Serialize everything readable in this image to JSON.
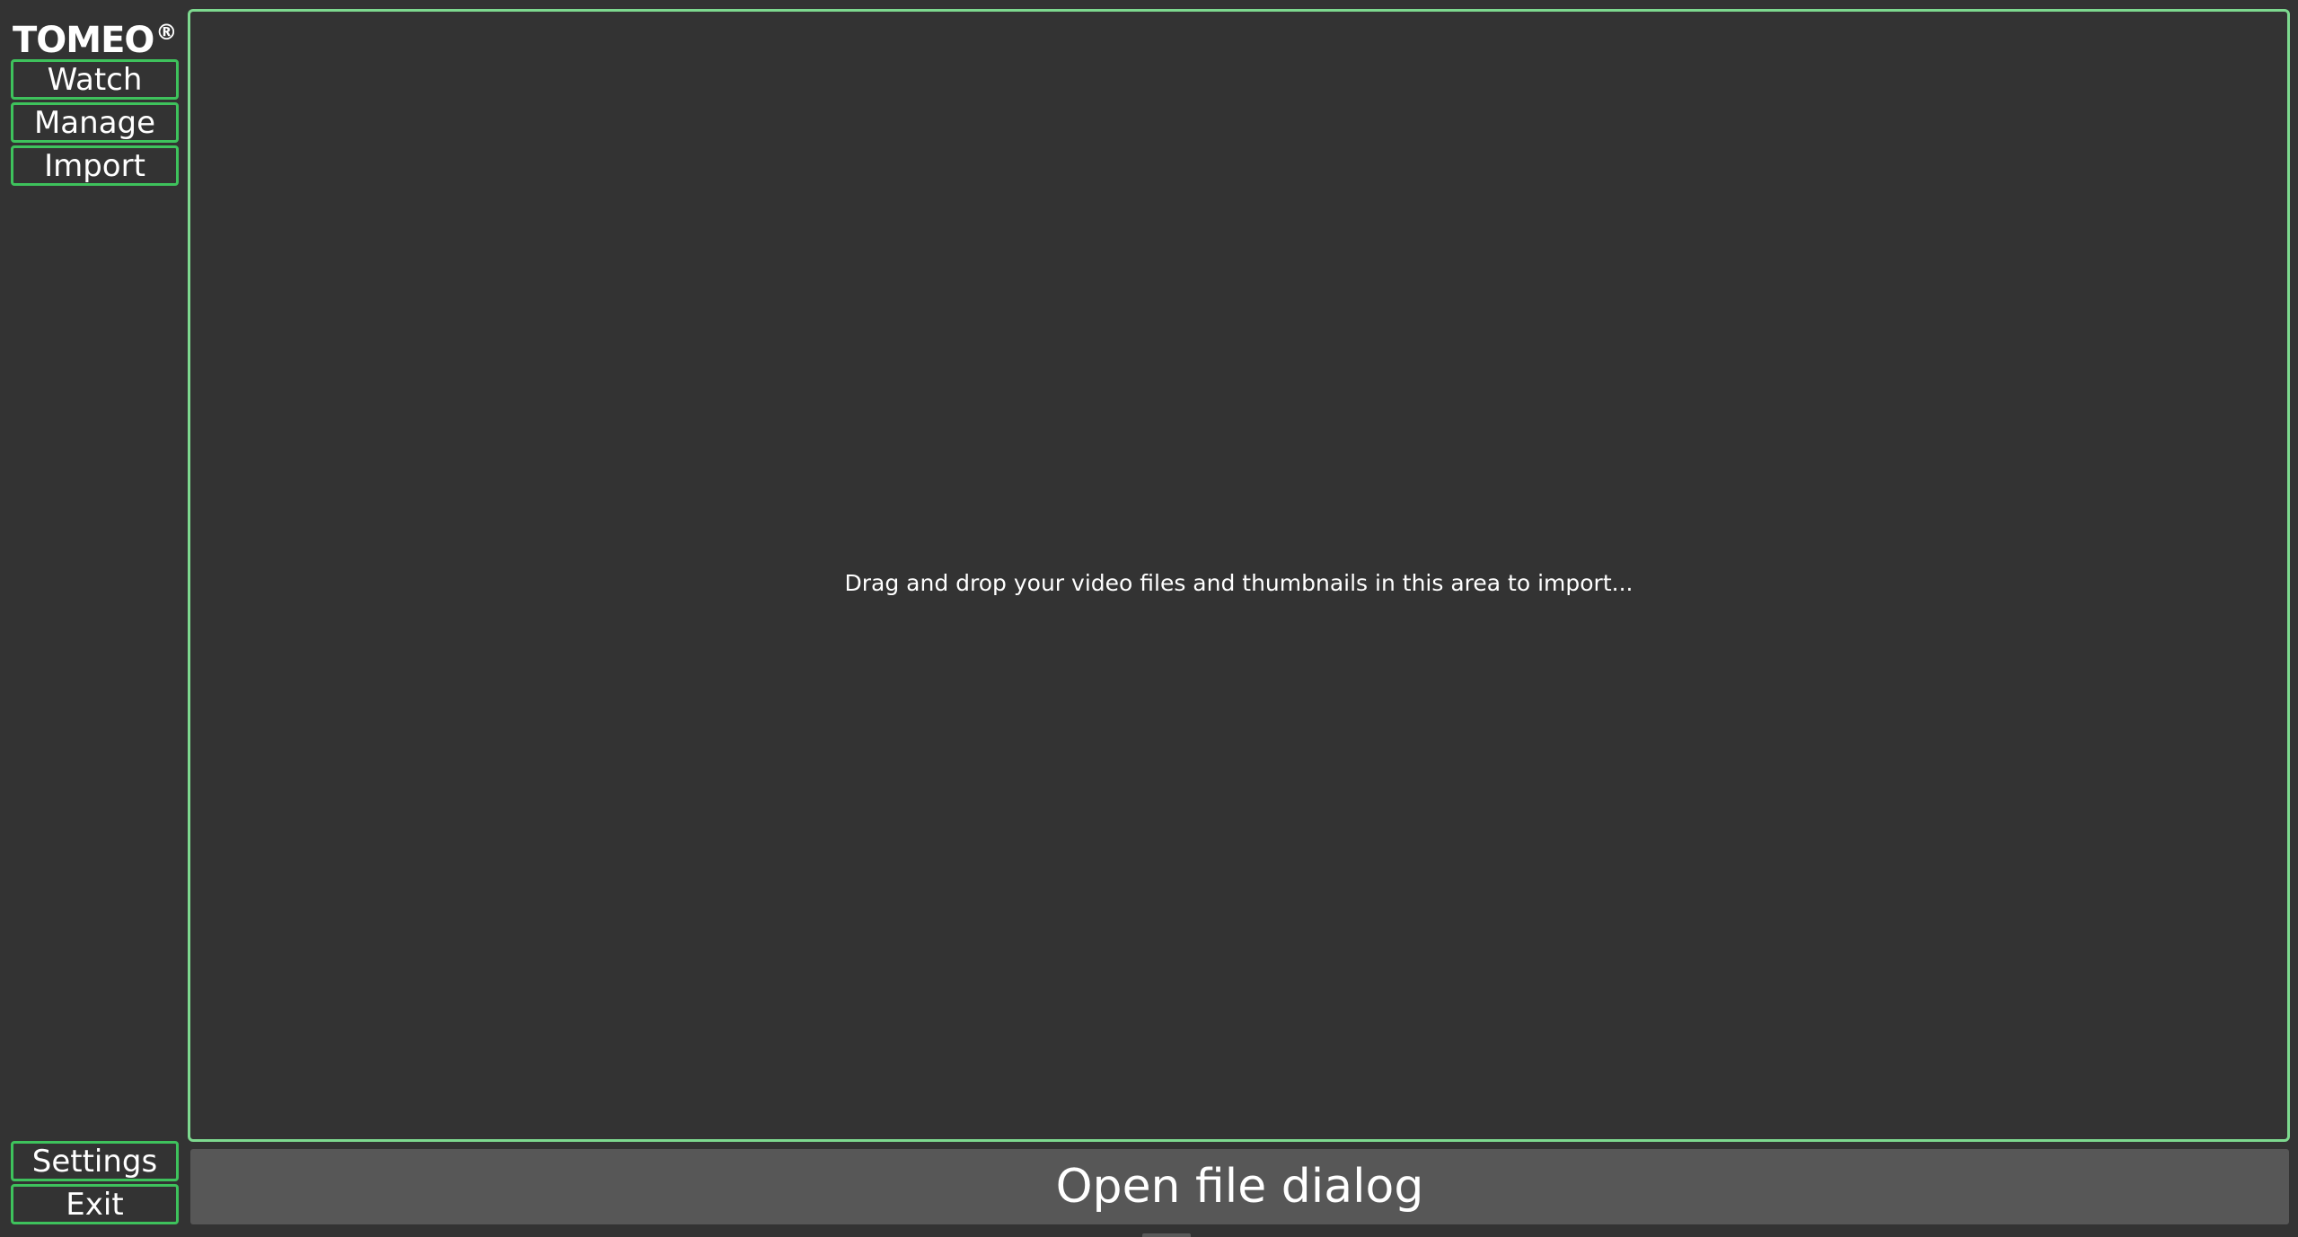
{
  "app": {
    "logo_text": "TOMEO",
    "logo_mark": "®"
  },
  "nav": {
    "watch_label": "Watch",
    "manage_label": "Manage",
    "import_label": "Import",
    "settings_label": "Settings",
    "exit_label": "Exit"
  },
  "import_view": {
    "drop_hint": "Drag and drop your video files and thumbnails in this area to import...",
    "open_dialog_label": "Open file dialog"
  },
  "colors": {
    "background": "#333333",
    "accent_border": "#3ec25c",
    "drop_border": "#7dd98f",
    "button_fill": "#575757",
    "text": "#ffffff"
  }
}
